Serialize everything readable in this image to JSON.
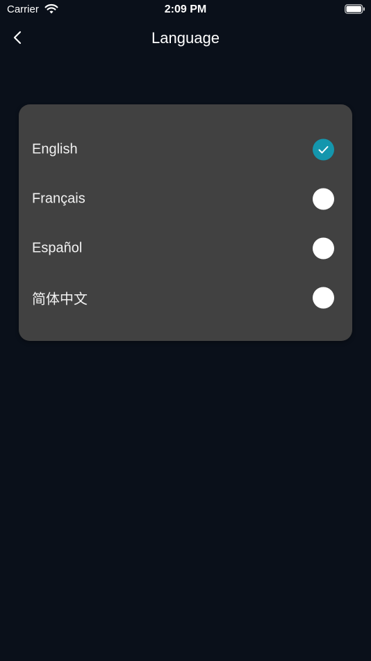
{
  "status_bar": {
    "carrier": "Carrier",
    "time": "2:09 PM"
  },
  "nav": {
    "title": "Language"
  },
  "languages": [
    {
      "label": "English",
      "selected": true
    },
    {
      "label": "Français",
      "selected": false
    },
    {
      "label": "Español",
      "selected": false
    },
    {
      "label": "简体中文",
      "selected": false
    }
  ],
  "colors": {
    "background": "#0a101a",
    "card": "#414141",
    "accent": "#1496ad"
  }
}
